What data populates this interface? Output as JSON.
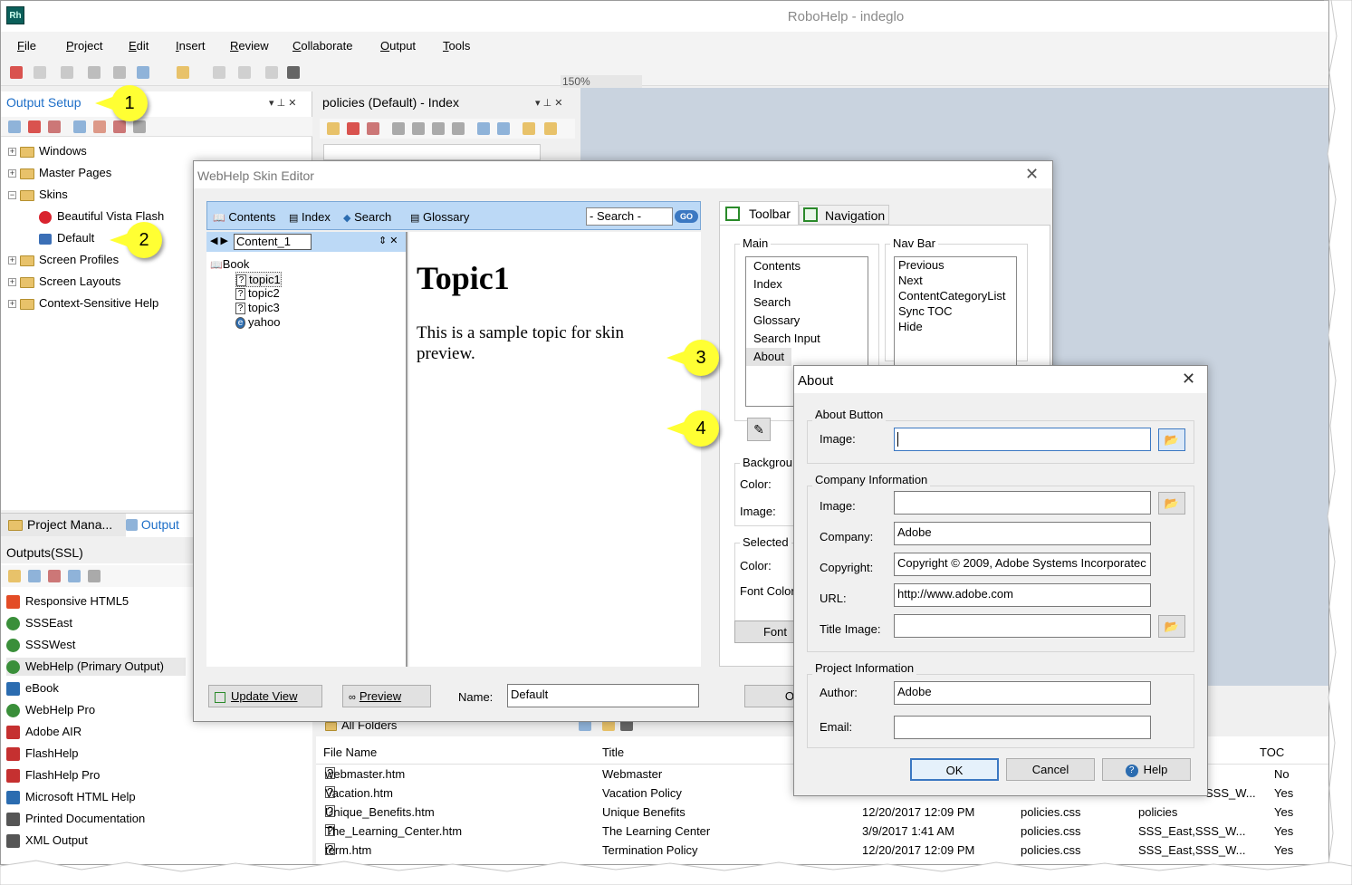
{
  "app": {
    "title": "RoboHelp - indeglo",
    "logo": "Rh",
    "menu": [
      "File",
      "Project",
      "Edit",
      "Insert",
      "Review",
      "Collaborate",
      "Output",
      "Tools"
    ],
    "zoom": "150%"
  },
  "output_setup": {
    "title": "Output Setup",
    "tree": {
      "windows": "Windows",
      "master_pages": "Master Pages",
      "skins": "Skins",
      "skin_beautiful": "Beautiful Vista Flash",
      "skin_default": "Default",
      "screen_profiles": "Screen Profiles",
      "screen_layouts": "Screen Layouts",
      "csh": "Context-Sensitive Help"
    },
    "tabs": {
      "project_manager": "Project Mana...",
      "output": "Output"
    }
  },
  "outputs": {
    "title": "Outputs(SSL)",
    "items": [
      {
        "label": "Responsive HTML5",
        "color": "#e34c26"
      },
      {
        "label": "SSSEast",
        "color": "#3a8f3a"
      },
      {
        "label": "SSSWest",
        "color": "#3a8f3a"
      },
      {
        "label": "WebHelp (Primary Output)",
        "color": "#3a8f3a"
      },
      {
        "label": "eBook",
        "color": "#2b6cb0"
      },
      {
        "label": "WebHelp Pro",
        "color": "#3a8f3a"
      },
      {
        "label": "Adobe AIR",
        "color": "#c53030"
      },
      {
        "label": "FlashHelp",
        "color": "#c53030"
      },
      {
        "label": "FlashHelp Pro",
        "color": "#c53030"
      },
      {
        "label": "Microsoft HTML Help",
        "color": "#2b6cb0"
      },
      {
        "label": "Printed Documentation",
        "color": "#555555"
      },
      {
        "label": "XML Output",
        "color": "#555555"
      }
    ]
  },
  "index_panel": {
    "title": "policies (Default) - Index"
  },
  "callouts": [
    "1",
    "2",
    "3",
    "4"
  ],
  "skin_editor": {
    "title": "WebHelp Skin Editor",
    "preview_tabs": {
      "contents": "Contents",
      "index": "Index",
      "search": "Search",
      "glossary": "Glossary"
    },
    "search_placeholder": "- Search -",
    "go": "GO",
    "content_select": "Content_1",
    "book": "Book",
    "topics": [
      "topic1",
      "topic2",
      "topic3",
      "yahoo"
    ],
    "topic_heading": "Topic1",
    "topic_body": "This is a sample topic for skin preview.",
    "tabs": {
      "toolbar": "Toolbar",
      "navigation": "Navigation"
    },
    "main_legend": "Main",
    "main_items": [
      "Contents",
      "Index",
      "Search",
      "Glossary",
      "Search Input",
      "About"
    ],
    "navbar_legend": "Nav Bar",
    "navbar_items": [
      "Previous",
      "Next",
      "ContentCategoryList",
      "Sync TOC",
      "Hide"
    ],
    "background_legend": "Backgrou",
    "color_label": "Color:",
    "image_label": "Image:",
    "selected_legend": "Selected",
    "selected_color_label": "Color:",
    "font_color_label": "Font Color",
    "font_button": "Font",
    "update_view": "Update View",
    "preview": "Preview",
    "name_label": "Name:",
    "name_value": "Default",
    "ok_partial": "O"
  },
  "about_dialog": {
    "title": "About",
    "about_button_legend": "About Button",
    "image_label": "Image:",
    "image_value": "",
    "company_legend": "Company Information",
    "company_image_label": "Image:",
    "company_label": "Company:",
    "company_value": "Adobe",
    "copyright_label": "Copyright:",
    "copyright_value": "Copyright © 2009, Adobe Systems Incorporatec",
    "url_label": "URL:",
    "url_value": "http://www.adobe.com",
    "title_image_label": "Title Image:",
    "project_legend": "Project Information",
    "author_label": "Author:",
    "author_value": "Adobe",
    "email_label": "Email:",
    "ok": "OK",
    "cancel": "Cancel",
    "help": "Help"
  },
  "files": {
    "folder": "All Folders",
    "columns": {
      "file_name": "File Name",
      "title": "Title",
      "toc": "TOC"
    },
    "rows": [
      {
        "file": "webmaster.htm",
        "title": "Webmaster",
        "date": "",
        "css": "",
        "cond": "",
        "toc": "No"
      },
      {
        "file": "Vacation.htm",
        "title": "Vacation Policy",
        "date": "",
        "css": "",
        "cond": "SSS_W...",
        "toc": "Yes"
      },
      {
        "file": "Unique_Benefits.htm",
        "title": "Unique Benefits",
        "date": "12/20/2017 12:09 PM",
        "css": "policies.css",
        "cond": "policies",
        "toc": "Yes"
      },
      {
        "file": "The_Learning_Center.htm",
        "title": "The Learning Center",
        "date": "3/9/2017 1:41 AM",
        "css": "policies.css",
        "cond": "SSS_East,SSS_W...",
        "toc": "Yes"
      },
      {
        "file": "term.htm",
        "title": "Termination Policy",
        "date": "12/20/2017 12:09 PM",
        "css": "policies.css",
        "cond": "SSS_East,SSS_W...",
        "toc": "Yes"
      }
    ]
  }
}
